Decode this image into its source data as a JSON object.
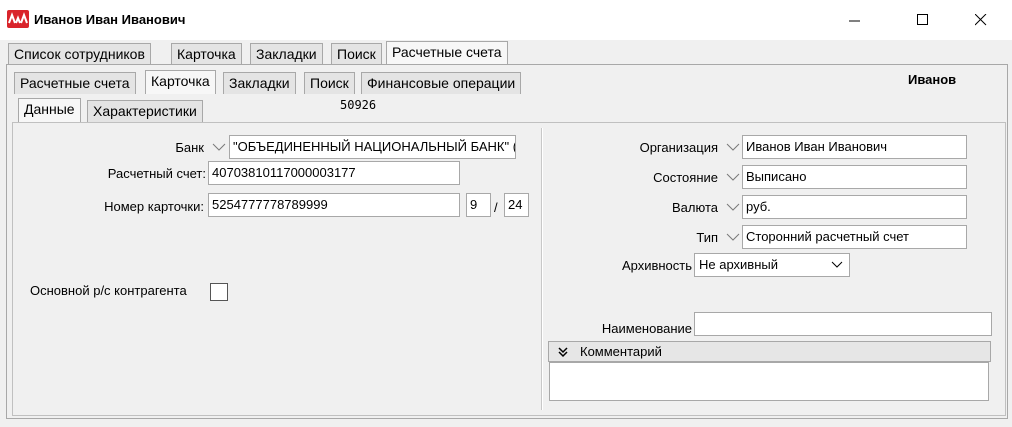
{
  "window": {
    "title": "Иванов Иван Иванович"
  },
  "tabs_level1": [
    {
      "label": "Список сотрудников"
    },
    {
      "label": "Карточка"
    },
    {
      "label": "Закладки"
    },
    {
      "label": "Поиск"
    },
    {
      "label": "Расчетные счета"
    }
  ],
  "tabs_level2": [
    {
      "label": "Расчетные счета"
    },
    {
      "label": "Карточка"
    },
    {
      "label": "Закладки"
    },
    {
      "label": "Поиск"
    },
    {
      "label": "Финансовые операции"
    }
  ],
  "tabs_level3": [
    {
      "label": "Данные"
    },
    {
      "label": "Характеристики"
    }
  ],
  "header": {
    "code": "50926",
    "person": "Иванов"
  },
  "form_left": {
    "bank_label": "Банк",
    "bank_value": "\"ОБЪЕДИНЕННЫЙ НАЦИОНАЛЬНЫЙ БАНК\" (",
    "account_label": "Расчетный счет:",
    "account_value": "40703810117000003177",
    "card_label": "Номер карточки:",
    "card_value": "5254777778789999",
    "card_month": "9",
    "card_sep": "/",
    "card_year": "24",
    "main_account_label": "Основной р/с контрагента"
  },
  "form_right": {
    "org_label": "Организация",
    "org_value": "Иванов Иван Иванович",
    "state_label": "Состояние",
    "state_value": "Выписано",
    "currency_label": "Валюта",
    "currency_value": "руб.",
    "type_label": "Тип",
    "type_value": "Сторонний расчетный счет",
    "archive_label": "Архивность",
    "archive_value": "Не архивный",
    "name_label": "Наименование",
    "name_value": "",
    "comment_label": "Комментарий",
    "comment_value": ""
  },
  "icons": {
    "app": "app-logo-icon",
    "minimize": "minimize-icon",
    "maximize": "maximize-icon",
    "close": "close-icon",
    "dropdown": "chevron-down-icon",
    "collapse": "double-chevron-down-icon"
  },
  "colors": {
    "app_icon": "#d9242b",
    "background": "#f0f0f0"
  }
}
